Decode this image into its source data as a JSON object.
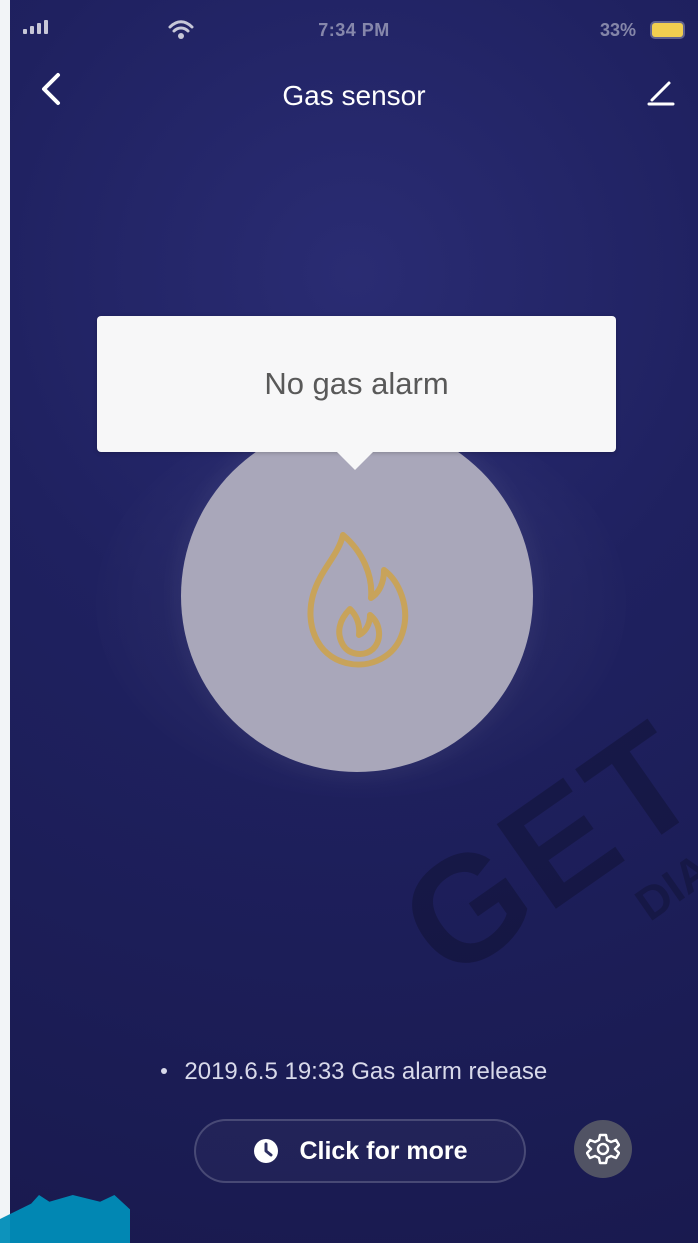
{
  "status_bar": {
    "time": "7:34 PM",
    "battery": "33%"
  },
  "header": {
    "title": "Gas sensor"
  },
  "tooltip": {
    "text": "No gas alarm"
  },
  "log": {
    "entry": "2019.6.5 19:33 Gas alarm release"
  },
  "actions": {
    "more_label": "Click for more"
  },
  "colors": {
    "background": "#1f2160",
    "sensor_circle": "#a9a7ba",
    "flame": "#c8a35a",
    "tooltip_background": "#f7f7f8",
    "settings_button": "#515364"
  },
  "icons": {
    "back": "chevron-left-icon",
    "edit": "edit-icon",
    "flame": "flame-icon",
    "clock": "clock-icon",
    "settings": "gear-icon"
  },
  "watermark": {
    "large": "GET",
    "small": "DIANA"
  }
}
